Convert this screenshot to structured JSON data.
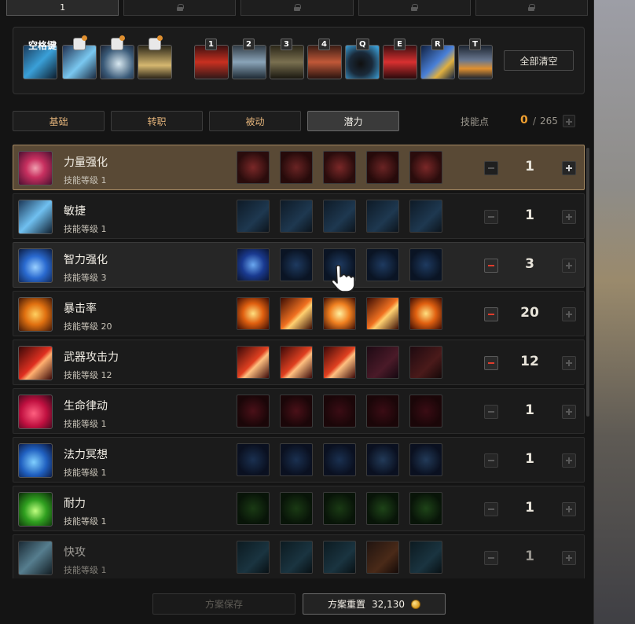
{
  "top_tabs": [
    {
      "label": "1",
      "locked": false
    },
    {
      "label": "",
      "locked": true
    },
    {
      "label": "",
      "locked": true
    },
    {
      "label": "",
      "locked": true
    },
    {
      "label": "",
      "locked": true
    }
  ],
  "hotbar": {
    "space_label": "空格键",
    "keys": [
      "1",
      "2",
      "3",
      "4",
      "Q",
      "E",
      "R",
      "T"
    ],
    "clear_label": "全部清空"
  },
  "categories": [
    "基础",
    "转职",
    "被动",
    "潜力"
  ],
  "active_category": "潜力",
  "skill_points": {
    "label": "技能点",
    "used": "0",
    "slash": "/",
    "total": "265"
  },
  "skills": [
    {
      "name": "力量强化",
      "level_text": "技能等级 1",
      "value": "1"
    },
    {
      "name": "敏捷",
      "level_text": "技能等级 1",
      "value": "1"
    },
    {
      "name": "智力强化",
      "level_text": "技能等级 3",
      "value": "3"
    },
    {
      "name": "暴击率",
      "level_text": "技能等级 20",
      "value": "20"
    },
    {
      "name": "武器攻击力",
      "level_text": "技能等级 12",
      "value": "12"
    },
    {
      "name": "生命律动",
      "level_text": "技能等级 1",
      "value": "1"
    },
    {
      "name": "法力冥想",
      "level_text": "技能等级 1",
      "value": "1"
    },
    {
      "name": "耐力",
      "level_text": "技能等级 1",
      "value": "1"
    },
    {
      "name": "快攻",
      "level_text": "技能等级 1",
      "value": "1"
    }
  ],
  "footer": {
    "save_label": "方案保存",
    "reset_label": "方案重置",
    "reset_cost": "32,130"
  },
  "colors": {
    "accent_orange": "#f0a030",
    "selected_row": "#594935",
    "minus_active": "#e03c2c"
  }
}
